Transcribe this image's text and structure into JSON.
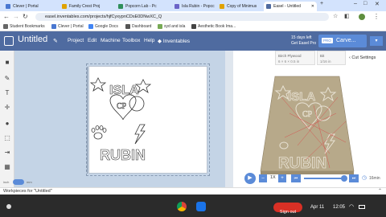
{
  "tabs": [
    {
      "label": "Clever | Portal",
      "color": "#4a78d1"
    },
    {
      "label": "Family Crest Proj",
      "color": "#e0a200"
    },
    {
      "label": "Popcorn Lab - Pc",
      "color": "#2f8f5b"
    },
    {
      "label": "Isla Rubin - Popcc",
      "color": "#6b64c7"
    },
    {
      "label": "Copy of Minimus",
      "color": "#e0a200"
    },
    {
      "label": "Easel - Untitled",
      "color": "#4f6ba0",
      "active": true
    }
  ],
  "address": {
    "url": "easel.inventables.com/projects/hjfCyxypnCDsE0DNwXC_Q"
  },
  "bookmarks": [
    {
      "label": "Student Bookmarks",
      "color": "#666"
    },
    {
      "label": "Clever | Portal",
      "color": "#4a78d1"
    },
    {
      "label": "Google Docs",
      "color": "#4285f4"
    },
    {
      "label": "Dashboard",
      "color": "#555"
    },
    {
      "label": "syd and isla",
      "color": "#7a5"
    },
    {
      "label": "Aesthetic Book Ima...",
      "color": "#444"
    }
  ],
  "app": {
    "title": "Untitled",
    "menu": [
      "Project",
      "Edit",
      "Machine",
      "Toolbox",
      "Help"
    ],
    "brand": "Inventables",
    "trial_line1": "15 days left",
    "trial_line2": "Get Easel Pro",
    "pro_badge": "PRO",
    "carve_label": "Carve..."
  },
  "material": {
    "name": "Birch Plywood",
    "size": "6 × 6 × 0.5 in",
    "bit_label": "Bit",
    "bit_size": "1/16 in",
    "cut_settings": "Cut Settings"
  },
  "design_text": {
    "top": "ISLA",
    "mono": "CP",
    "bottom": "RUBIN"
  },
  "playback": {
    "speed": "1X",
    "time": "16min"
  },
  "workpieces": "Workpieces for \"Untitled\"",
  "unit_toggle": {
    "left": "inch",
    "right": "mm"
  },
  "taskbar": {
    "sign_out": "Sign out",
    "date": "Apr 11",
    "time": "12:05"
  },
  "colors": {
    "accent": "#4f6ba0",
    "carve": "#5b8bd8",
    "wood": "#b7a98a",
    "redpath": "#d94848"
  }
}
